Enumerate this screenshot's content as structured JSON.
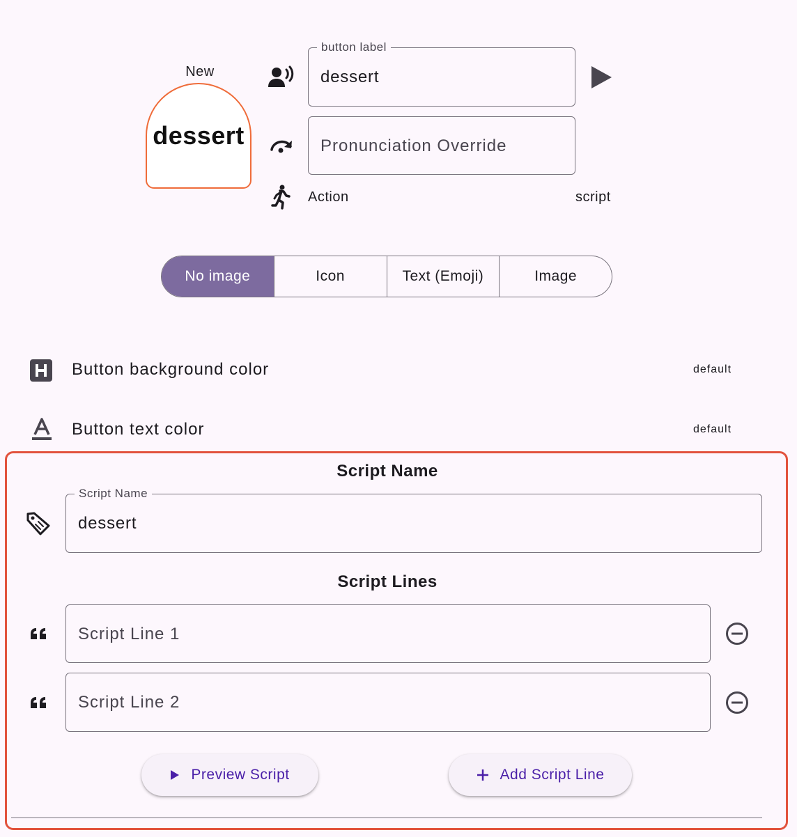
{
  "preview": {
    "badge": "New",
    "label": "dessert"
  },
  "fields": {
    "button_label": {
      "label": "button label",
      "value": "dessert"
    },
    "pronunciation": {
      "placeholder": "Pronunciation Override"
    }
  },
  "action": {
    "label": "Action",
    "value": "script"
  },
  "image_options": {
    "items": [
      "No image",
      "Icon",
      "Text (Emoji)",
      "Image"
    ],
    "selected": "No image"
  },
  "color_rows": {
    "background": {
      "label": "Button background color",
      "value": "default"
    },
    "text": {
      "label": "Button text color",
      "value": "default"
    }
  },
  "script": {
    "name_title": "Script Name",
    "name_field": {
      "label": "Script Name",
      "value": "dessert"
    },
    "lines_title": "Script Lines",
    "lines": [
      {
        "placeholder": "Script Line 1"
      },
      {
        "placeholder": "Script Line 2"
      }
    ],
    "preview_button": "Preview Script",
    "add_button": "Add Script Line"
  },
  "colors": {
    "accent_primary": "#7d6b9f",
    "preview_border": "#ef6c3a",
    "highlight_border": "#e2533d",
    "button_text": "#4a1fa8"
  }
}
